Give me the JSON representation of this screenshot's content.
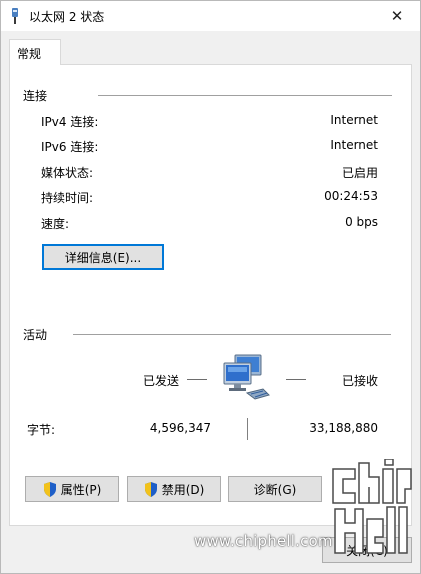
{
  "window": {
    "title": "以太网 2 状态",
    "close_symbol": "✕"
  },
  "tabs": [
    {
      "label": "常规"
    }
  ],
  "connection": {
    "title": "连接",
    "rows": [
      {
        "label": "IPv4 连接:",
        "value": "Internet"
      },
      {
        "label": "IPv6 连接:",
        "value": "Internet"
      },
      {
        "label": "媒体状态:",
        "value": "已启用"
      },
      {
        "label": "持续时间:",
        "value": "00:24:53"
      },
      {
        "label": "速度:",
        "value": "0 bps"
      }
    ],
    "details_button": "详细信息(E)..."
  },
  "activity": {
    "title": "活动",
    "sent_label": "已发送",
    "received_label": "已接收",
    "bytes_label": "字节:",
    "bytes_sent": "4,596,347",
    "bytes_received": "33,188,880"
  },
  "buttons": {
    "properties": "属性(P)",
    "disable": "禁用(D)",
    "diagnose": "诊断(G)",
    "close": "关闭(C)"
  },
  "watermark": {
    "text": "www.chiphell.com",
    "logo": "chiphell-logo"
  },
  "colors": {
    "focus_border": "#0078d7",
    "button_face": "#e1e1e1",
    "shield_blue": "#1e5fc8",
    "shield_yellow": "#f2c21b"
  }
}
